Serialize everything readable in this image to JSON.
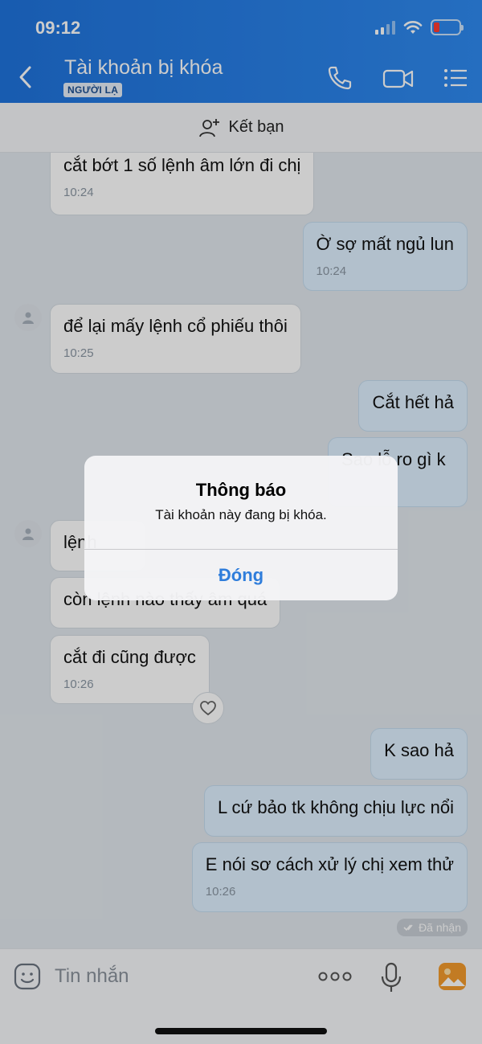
{
  "status_bar": {
    "time": "09:12"
  },
  "header": {
    "title": "Tài khoản bị khóa",
    "badge": "NGƯỜI LẠ"
  },
  "friend_bar": {
    "label": "Kết bạn"
  },
  "messages": [
    {
      "dir": "in",
      "text": "cắt bớt 1 số lệnh âm lớn đi chị",
      "time": "10:24"
    },
    {
      "dir": "out",
      "text": "Ờ sợ mất ngủ lun",
      "time": "10:24"
    },
    {
      "dir": "in",
      "text": "để lại mấy lệnh cổ phiếu thôi",
      "time": "10:25"
    },
    {
      "dir": "out",
      "text": "Cắt hết hả",
      "time": ""
    },
    {
      "dir": "out",
      "text": "Sao lỗ ro gì k",
      "time": ""
    },
    {
      "dir": "in",
      "text": "lệnh",
      "time": ""
    },
    {
      "dir": "in",
      "text": "còn lệnh nào thấy âm quá",
      "time": ""
    },
    {
      "dir": "in",
      "text": "cắt đi cũng được",
      "time": "10:26"
    },
    {
      "dir": "out",
      "text": "K sao hả",
      "time": ""
    },
    {
      "dir": "out",
      "text": "L cứ bảo tk không chịu lực nổi",
      "time": ""
    },
    {
      "dir": "out",
      "text": "E nói sơ cách xử lý chị xem thử",
      "time": "10:26"
    }
  ],
  "received_label": "Đã nhận",
  "input": {
    "placeholder": "Tin nhắn"
  },
  "dialog": {
    "title": "Thông báo",
    "message": "Tài khoản này đang bị khóa.",
    "button": "Đóng"
  }
}
